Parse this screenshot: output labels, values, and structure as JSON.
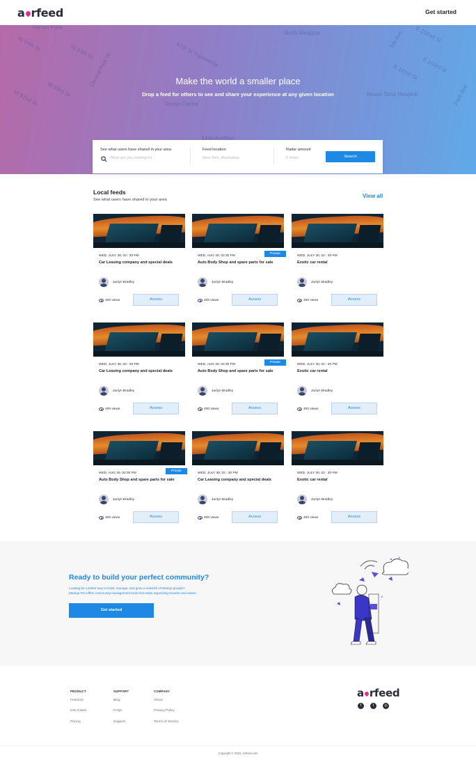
{
  "header": {
    "logo_text_a": "a",
    "logo_text_rest": "rfeed",
    "cta_label": "Get started"
  },
  "hero": {
    "title": "Make the world a smaller place",
    "subtitle": "Drop a feed for others to see and share your experience at any given location",
    "map_labels": [
      "Hunan Park",
      "W 94th St",
      "W 95th St",
      "Central Park W",
      "97th St Transverse",
      "W 93rd St",
      "W 92nd St",
      "Tennis Center",
      "Manhattan",
      "North Meadow",
      "5th Ave",
      "E 102nd St",
      "E 103rd St",
      "E 101st St",
      "Mount Sinai Hospital",
      "Park Ave"
    ]
  },
  "search": {
    "field1_label": "See what users have shared in your area",
    "field1_placeholder": "What are you looking for",
    "field2_label": "Feed location",
    "field2_placeholder": "New York, Manhattan",
    "field3_label": "Radar amount",
    "field3_placeholder": "5 miles",
    "button_label": "Search"
  },
  "local_feeds": {
    "title": "Local feeds",
    "subtitle": "See what users have shared in your area",
    "view_all": "View all",
    "cards": [
      {
        "date": "WED, JULY 30, 02 : 30 PM",
        "title": "Car Leasing company and special deals",
        "author": "Jaclyn Bradley",
        "views": "400 views",
        "access": "Access",
        "badge": ""
      },
      {
        "date": "WED, AUG 29, 02:30 PM",
        "title": "Auto Body Shop and spare parts for sale",
        "author": "Jaclyn Bradley",
        "views": "400 views",
        "access": "Access",
        "badge": "Private"
      },
      {
        "date": "WED, JULY 30, 02 : 30 PM",
        "title": "Exotic car rental",
        "author": "Jaclyn Bradley",
        "views": "400 views",
        "access": "Access",
        "badge": ""
      },
      {
        "date": "WED, JULY 30, 02 : 30 PM",
        "title": "Car Leasing company and special deals",
        "author": "Jaclyn Bradley",
        "views": "400 views",
        "access": "Access",
        "badge": ""
      },
      {
        "date": "WED, AUG 29, 02:30 PM",
        "title": "Auto Body Shop and spare parts for sale",
        "author": "Jaclyn Bradley",
        "views": "400 views",
        "access": "Access",
        "badge": "Private"
      },
      {
        "date": "WED, JULY 30, 02 : 30 PM",
        "title": "Exotic car rental",
        "author": "Jaclyn Bradley",
        "views": "400 views",
        "access": "Access",
        "badge": ""
      },
      {
        "date": "WED, AUG 29, 02:30 PM",
        "title": "Auto Body Shop and spare parts for sale",
        "author": "Jaclyn Bradley",
        "views": "400 views",
        "access": "Access",
        "badge": "Private"
      },
      {
        "date": "WED, JULY 30, 02 : 30 PM",
        "title": "Car Leasing company and special deals",
        "author": "Jaclyn Bradley",
        "views": "400 views",
        "access": "Access",
        "badge": ""
      },
      {
        "date": "WED, JULY 30, 02 : 30 PM",
        "title": "Exotic car rental",
        "author": "Jaclyn Bradley",
        "views": "400 views",
        "access": "Access",
        "badge": ""
      }
    ]
  },
  "cta": {
    "title": "Ready to build your perfect community?",
    "desc1": "Looking for a better way to build, manage, and grow a network of Meetup groups?",
    "desc2": "Meetup Pro offers community management tools that make organizing smarter and easier.",
    "button_label": "Get started"
  },
  "footer": {
    "columns": [
      {
        "heading": "PRODUCT",
        "links": [
          "Features",
          "Use Cases",
          "Pricing"
        ]
      },
      {
        "heading": "SUPPORT",
        "links": [
          "Blog",
          "FAQs",
          "Support"
        ]
      },
      {
        "heading": "COMPANY",
        "links": [
          "About",
          "Privacy Policy",
          "Terms of Service"
        ]
      }
    ],
    "social_icons": [
      "facebook-icon",
      "twitter-icon",
      "instagram-icon"
    ],
    "copyright": "Copyright © 2016, Airfeed.com"
  },
  "colors": {
    "accent": "#1e88e5",
    "pin": "#d9328f",
    "hero_start": "#b56aa8",
    "hero_end": "#60a9e8"
  }
}
